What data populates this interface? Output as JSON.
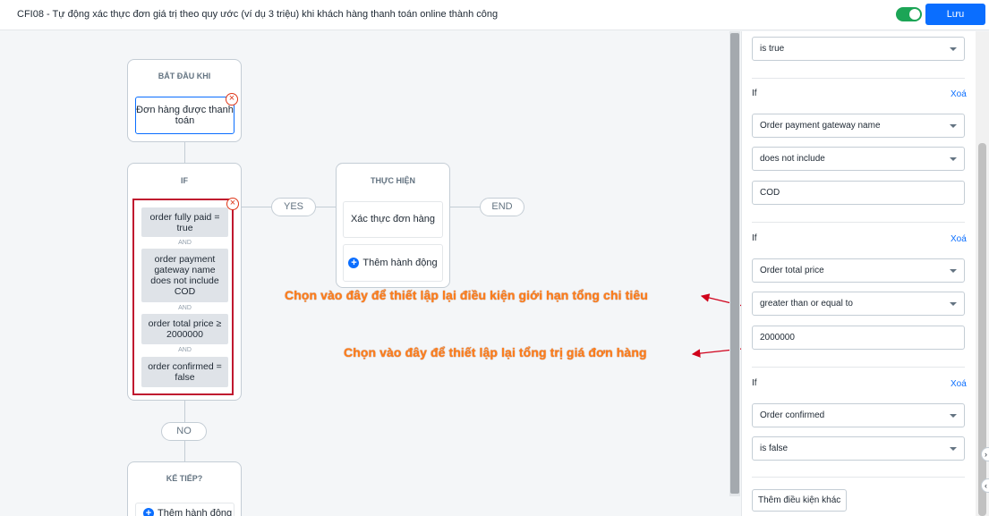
{
  "header": {
    "title": "CFI08 - Tự động xác thực đơn giá trị theo quy ước (ví dụ 3 triệu) khi khách hàng thanh toán online thành công",
    "toggle_on": true,
    "save_label": "Lưu"
  },
  "flow": {
    "trigger": {
      "heading": "BẮT ĐẦU KHI",
      "event_label": "Đơn hàng được thanh toán"
    },
    "if_block": {
      "heading": "IF",
      "conditions": [
        "order fully paid = true",
        "order payment gateway name does not include COD",
        "order total price ≥ 2000000",
        "order confirmed = false"
      ],
      "and_label": "AND"
    },
    "yes_label": "YES",
    "no_label": "NO",
    "end_label": "END",
    "action_block": {
      "heading": "THỰC HIỆN",
      "action_label": "Xác thực đơn hàng",
      "add_action_label": "Thêm hành động"
    },
    "next_block": {
      "heading": "KẾ TIẾP?",
      "add_label": "Thêm hành động"
    }
  },
  "annotations": {
    "condition_note": "Chọn vào đây để thiết lập lại điều kiện giới hạn tổng chi tiêu",
    "value_note": "Chọn vào đây để thiết lập lại tổng trị giá đơn hàng",
    "color": "#ff7e1b",
    "arrow_color": "#d0021b"
  },
  "panel": {
    "top_select": "is true",
    "groups": [
      {
        "if_label": "If",
        "delete_label": "Xoá",
        "field": "Order payment gateway name",
        "operator": "does not include",
        "value": "COD"
      },
      {
        "if_label": "If",
        "delete_label": "Xoá",
        "field": "Order total price",
        "operator": "greater than or equal to",
        "value": "2000000"
      },
      {
        "if_label": "If",
        "delete_label": "Xoá",
        "field": "Order confirmed",
        "operator": "is false"
      }
    ],
    "add_condition_label": "Thêm điều kiện khác"
  },
  "icons": {
    "remove": "close-circle-icon",
    "add": "plus-circle-icon",
    "dropdown": "chevron-down-icon"
  },
  "colors": {
    "primary": "#0a6eff",
    "toggle_on": "#1ca556",
    "highlight_frame": "#c0182f",
    "remove": "#de3618"
  }
}
